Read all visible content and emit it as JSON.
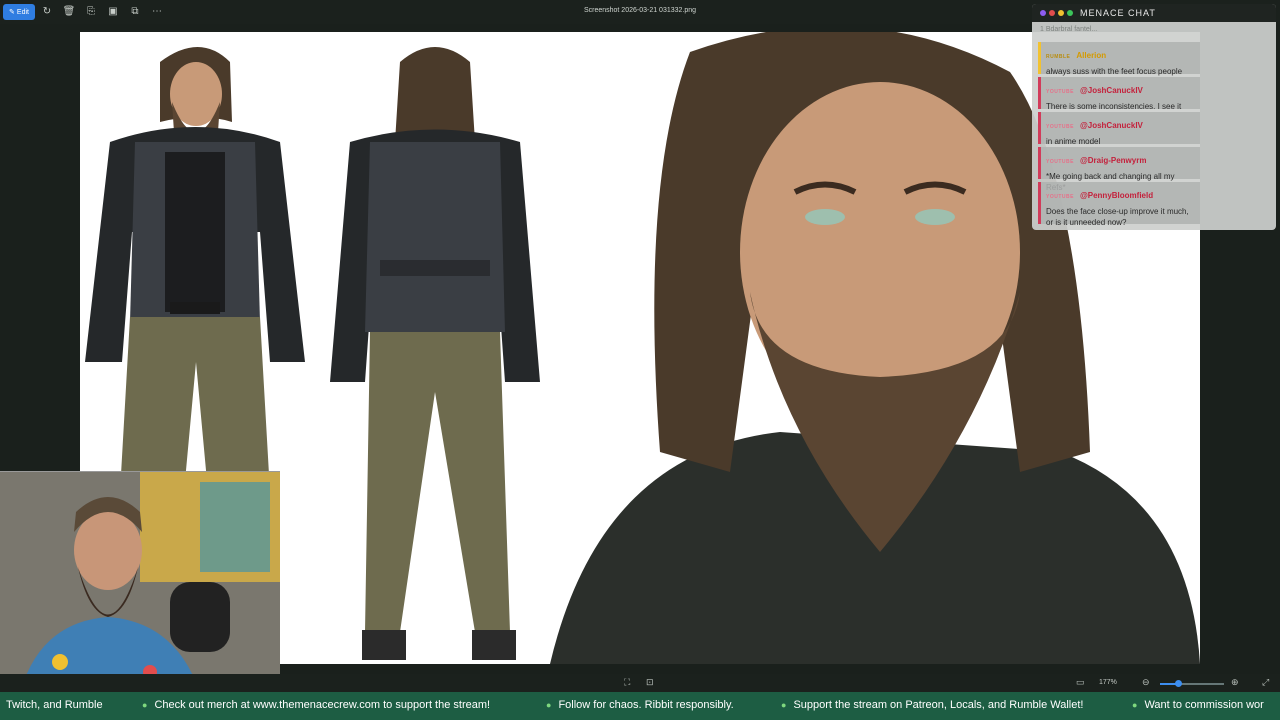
{
  "toolbar": {
    "edit_label": "Edit",
    "file_title": "Screenshot 2026-03-21 031332.png",
    "icons": [
      "rotate-icon",
      "delete-icon",
      "share-icon",
      "image-icon",
      "copy-icon",
      "more-icon"
    ]
  },
  "chat": {
    "title": "MENACE CHAT",
    "truncated_text": "1 Bdarbral fantel...",
    "messages": [
      {
        "source": "RUMBLE",
        "user": "Allerion",
        "text": "always suss with the feet focus people"
      },
      {
        "source": "YOUTUBE",
        "user": "@JoshCanuckIV",
        "text": "There is some inconsistencies. I see it"
      },
      {
        "source": "YOUTUBE",
        "user": "@JoshCanuckIV",
        "text": "in anime model"
      },
      {
        "source": "YOUTUBE",
        "user": "@Draig-Penwyrm",
        "text": "*Me going back and changing all my Refs*"
      },
      {
        "source": "YOUTUBE",
        "user": "@PennyBloomfield",
        "text": "Does the face close-up improve it much, or is it unneeded now?"
      }
    ]
  },
  "viewer": {
    "zoom_label": "177%",
    "zoom_fraction": 0.28
  },
  "ticker": {
    "items": [
      "Twitch, and Rumble",
      "Check out merch at www.themenacecrew.com to support the stream!",
      "Follow for chaos. Ribbit responsibly.",
      "Support the stream on Patreon, Locals, and Rumble Wallet!",
      "Want to commission wor"
    ]
  },
  "colors": {
    "accent": "#2f7de1",
    "ticker_bg": "#1d5d43",
    "youtube": "#d23b5a",
    "rumble": "#f2c230"
  }
}
